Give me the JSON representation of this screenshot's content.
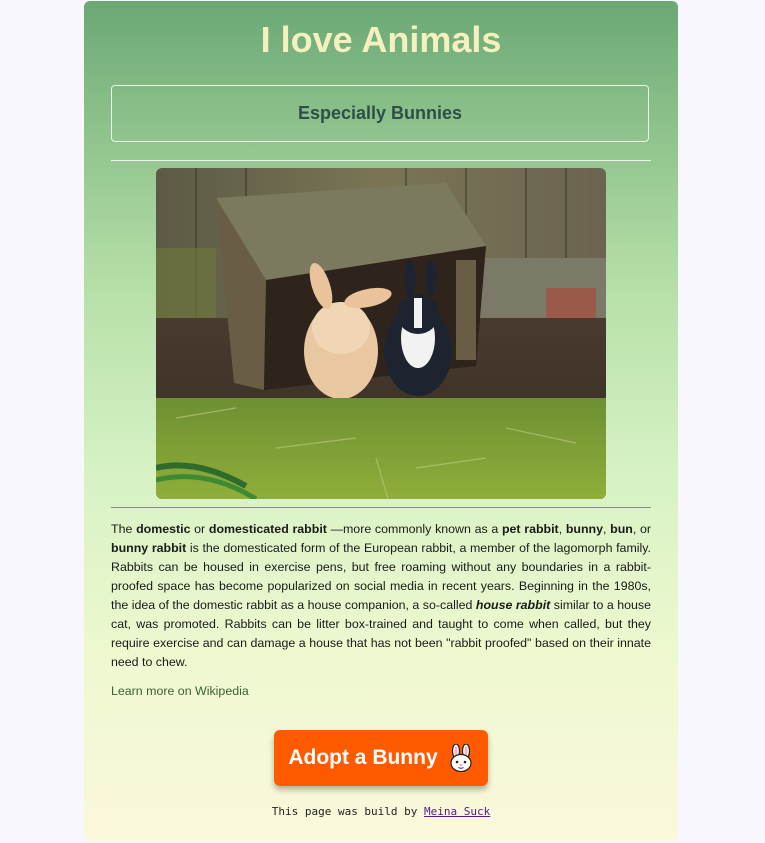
{
  "header": {
    "title": "I love Animals"
  },
  "subheader": {
    "title": "Especially Bunnies"
  },
  "content": {
    "paragraph": [
      {
        "t": "The ",
        "b": false
      },
      {
        "t": "domestic",
        "b": true
      },
      {
        "t": " or ",
        "b": false
      },
      {
        "t": "domesticated rabbit",
        "b": true
      },
      {
        "t": " —more commonly known as a ",
        "b": false
      },
      {
        "t": "pet rabbit",
        "b": true
      },
      {
        "t": ", ",
        "b": false
      },
      {
        "t": "bunny",
        "b": true
      },
      {
        "t": ", ",
        "b": false
      },
      {
        "t": "bun",
        "b": true
      },
      {
        "t": ", or ",
        "b": false
      },
      {
        "t": "bunny rabbit",
        "b": true
      },
      {
        "t": " is the domesticated form of the European rabbit, a member of the lagomorph family. Rabbits can be housed in exercise pens, but free roaming without any boundaries in a rabbit-proofed space has become popularized on social media in recent years. Beginning in the 1980s, the idea of the domestic rabbit as a house companion, a so-called ",
        "b": false
      },
      {
        "t": "house rabbit",
        "b": true,
        "i": true
      },
      {
        "t": " similar to a house cat, was promoted. Rabbits can be litter box-trained and taught to come when called, but they require exercise and can damage a house that has not been \"rabbit proofed\" based on their innate need to chew.",
        "b": false
      }
    ],
    "learn_more": "Learn more on Wikipedia"
  },
  "cta": {
    "label": "Adopt a Bunny"
  },
  "footer": {
    "prefix": "This page was build by ",
    "author": "Meina Suck"
  },
  "colors": {
    "button": "#ff5a00",
    "title": "#f4f0c0",
    "subtitle": "#2e4e4a",
    "link": "#3b6235"
  }
}
